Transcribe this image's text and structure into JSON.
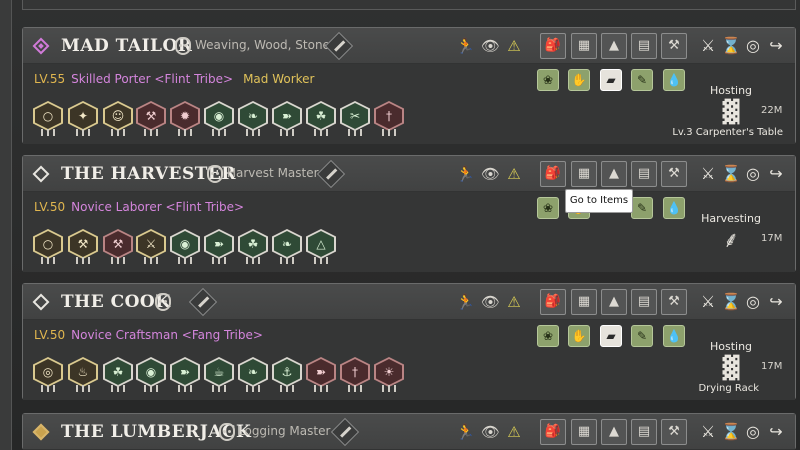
{
  "cards": [
    {
      "name": "MAD TAILOR",
      "traits": "Weaving, Wood, Stone",
      "level": "LV.55",
      "species": "Skilled Porter <Flint Tribe>",
      "rank": "Mad Worker",
      "status": {
        "label": "Hosting",
        "time": "22M",
        "sub": "Lv.3 Carpenter's Table"
      },
      "marker": "pink"
    },
    {
      "name": "THE HARVESTER",
      "traits": "Harvest Master",
      "level": "LV.50",
      "species": "Novice Laborer <Flint Tribe>",
      "rank": "",
      "status": {
        "label": "Harvesting",
        "time": "17M",
        "sub": ""
      },
      "marker": "white"
    },
    {
      "name": "THE COOK",
      "traits": "",
      "level": "LV.50",
      "species": "Novice Craftsman <Fang Tribe>",
      "rank": "",
      "status": {
        "label": "Hosting",
        "time": "17M",
        "sub": "Drying Rack"
      },
      "marker": "white"
    },
    {
      "name": "THE LUMBERJACK",
      "traits": "Logging Master",
      "marker": "gold"
    }
  ],
  "tooltip": "Go to Items",
  "icons": {
    "header_status": [
      "runner-icon",
      "eye-slash-icon",
      "warning-icon"
    ],
    "work_types": [
      "backpack-icon",
      "storage-icon",
      "triangle-icon",
      "id-card-icon",
      "anvil-icon"
    ],
    "actions": [
      "crossed-swords-icon",
      "hourglass-icon",
      "compass-icon",
      "logout-icon"
    ]
  },
  "colors": {
    "accent_pink": "#d485dc",
    "level_gold": "#e0b64f",
    "skill_green": "#8da16c"
  }
}
